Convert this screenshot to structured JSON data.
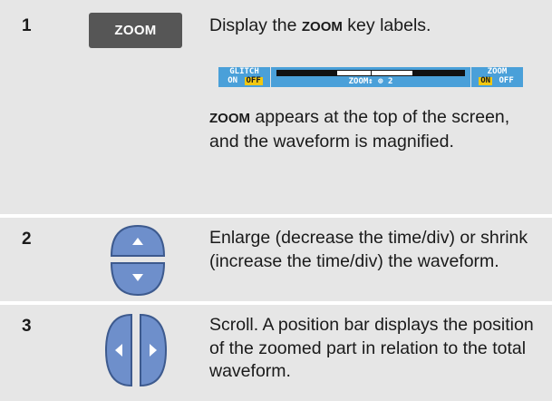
{
  "steps": [
    {
      "number": "1",
      "key_label": "ZOOM",
      "desc_line1": "Display the ",
      "desc_kw1": "ZOOM",
      "desc_line1_end": " key labels.",
      "key_labels": {
        "glitch": {
          "title": "GLITCH",
          "on": "ON",
          "off": "OFF",
          "active": "OFF"
        },
        "zoom_control": "ZOOM↕ ⊕ 2",
        "zoom": {
          "title": "ZOOM",
          "on": "ON",
          "off": "OFF",
          "active": "ON"
        }
      },
      "desc_kw2": "ZOOM",
      "desc_para2": " appears at the top of the screen, and the waveform is magnified."
    },
    {
      "number": "2",
      "keys": [
        "up-arrow-key",
        "down-arrow-key"
      ],
      "description": "Enlarge (decrease the time/div) or shrink (increase the time/div) the waveform."
    },
    {
      "number": "3",
      "keys": [
        "left-arrow-key",
        "right-arrow-key"
      ],
      "description": "Scroll. A position bar displays the position of the zoomed part in relation to the total waveform."
    }
  ],
  "colors": {
    "row_bg": "#e6e6e6",
    "key_bg": "#565656",
    "arrow_key_fill": "#6e8fcb",
    "label_bg": "#4aa0d9",
    "highlight": "#f2c811"
  }
}
